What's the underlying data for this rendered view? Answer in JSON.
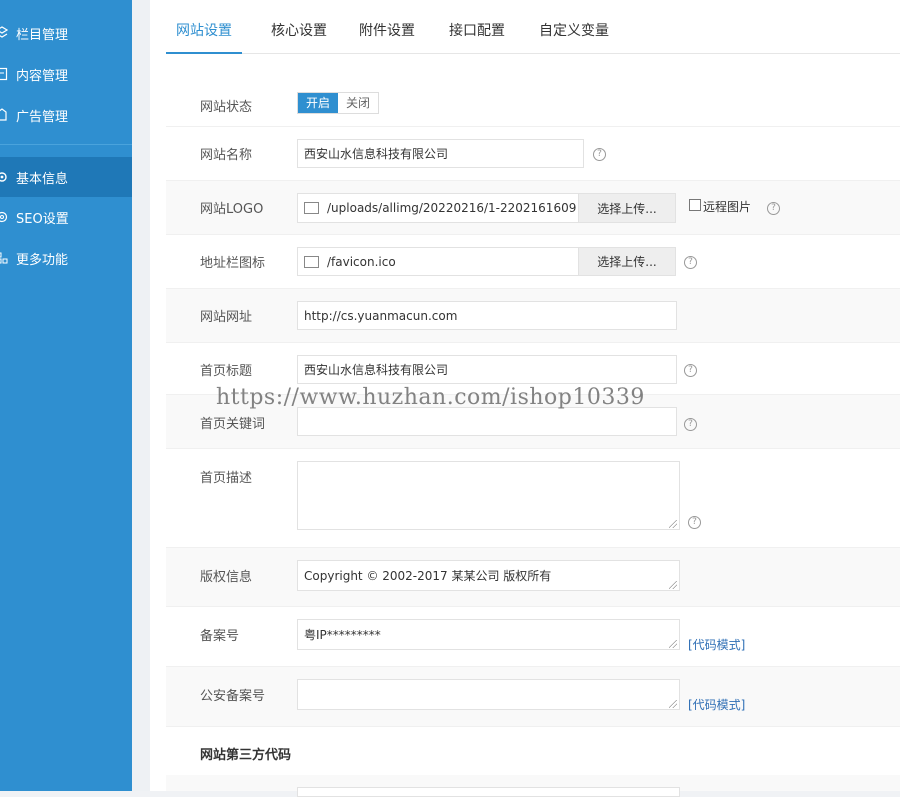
{
  "sidebar": {
    "items": [
      {
        "label": "栏目管理",
        "icon": "layers-icon"
      },
      {
        "label": "内容管理",
        "icon": "document-icon"
      },
      {
        "label": "广告管理",
        "icon": "ad-icon"
      },
      {
        "label": "基本信息",
        "icon": "gear-icon"
      },
      {
        "label": "SEO设置",
        "icon": "seo-icon"
      },
      {
        "label": "更多功能",
        "icon": "grid-icon"
      }
    ]
  },
  "tabs": [
    "网站设置",
    "核心设置",
    "附件设置",
    "接口配置",
    "自定义变量"
  ],
  "form": {
    "status": {
      "label": "网站状态",
      "on": "开启",
      "off": "关闭"
    },
    "name": {
      "label": "网站名称",
      "value": "西安山水信息科技有限公司"
    },
    "logo": {
      "label": "网站LOGO",
      "value": "/uploads/allimg/20220216/1-2202161609",
      "button": "选择上传...",
      "remote": "远程图片"
    },
    "favicon": {
      "label": "地址栏图标",
      "value": "/favicon.ico",
      "button": "选择上传..."
    },
    "url": {
      "label": "网站网址",
      "value": "http://cs.yuanmacun.com"
    },
    "home_title": {
      "label": "首页标题",
      "value": "西安山水信息科技有限公司"
    },
    "keywords": {
      "label": "首页关键词",
      "value": ""
    },
    "description": {
      "label": "首页描述",
      "value": ""
    },
    "copyright": {
      "label": "版权信息",
      "value": "Copyright © 2002-2017 某某公司 版权所有"
    },
    "icp": {
      "label": "备案号",
      "value": "粤IP*********",
      "link": "[代码模式]"
    },
    "police": {
      "label": "公安备案号",
      "value": "",
      "link": "[代码模式]"
    },
    "third_party_title": "网站第三方代码"
  },
  "watermark": "https://www.huzhan.com/ishop10339",
  "colors": {
    "accent": "#2f8fd0",
    "sidebar": "#2f8fd0",
    "sidebar_active": "#1f78b7"
  }
}
